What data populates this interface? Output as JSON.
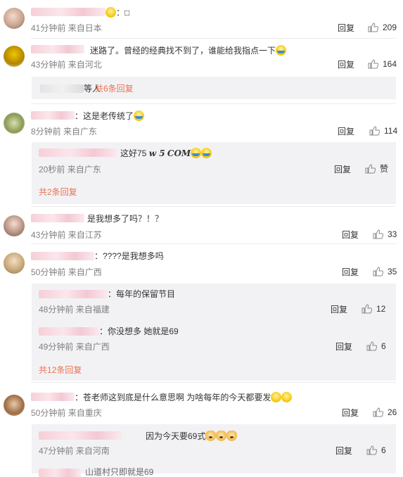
{
  "like_icon": "thumbs-up-icon",
  "comments": [
    {
      "text": "：□",
      "time": "41分钟前",
      "loc": "来自日本",
      "reply": "回复",
      "likes": "209"
    },
    {
      "text": "迷路了。曾经的经典找不到了，谁能给我指点一下",
      "time": "43分钟前",
      "loc": "来自河北",
      "reply": "回复",
      "likes": "164",
      "subsummary": {
        "name_tail": "等人",
        "more": "共6条回复"
      }
    },
    {
      "text": "：这是老传统了",
      "time": "8分钟前",
      "loc": "来自广东",
      "reply": "回复",
      "likes": "114",
      "subs": [
        {
          "text_a": "这好75",
          "text_b": "w 5",
          "text_c": "COM",
          "time": "20秒前",
          "loc": "来自广东",
          "reply": "回复",
          "likes": "赞"
        }
      ],
      "more": "共2条回复"
    },
    {
      "text": "是我想多了吗？！？",
      "time": "43分钟前",
      "loc": "来自江苏",
      "reply": "回复",
      "likes": "33"
    },
    {
      "text": "：????是我想多吗",
      "time": "50分钟前",
      "loc": "来自广西",
      "reply": "回复",
      "likes": "35",
      "subs": [
        {
          "text": "：每年的保留节目",
          "time": "48分钟前",
          "loc": "来自福建",
          "reply": "回复",
          "likes": "12"
        },
        {
          "text": "：你没想多 她就是69",
          "time": "49分钟前",
          "loc": "来自广西",
          "reply": "回复",
          "likes": "6"
        }
      ],
      "more": "共12条回复"
    },
    {
      "text": "：苍老师这到底是什么意思啊 为啥每年的今天都要发",
      "time": "50分钟前",
      "loc": "来自重庆",
      "reply": "回复",
      "likes": "26",
      "subs": [
        {
          "text": "因为今天要69式",
          "time": "47分钟前",
          "loc": "来自河南",
          "reply": "回复",
          "likes": "6"
        }
      ],
      "partial": "山道村只即就是69"
    }
  ]
}
